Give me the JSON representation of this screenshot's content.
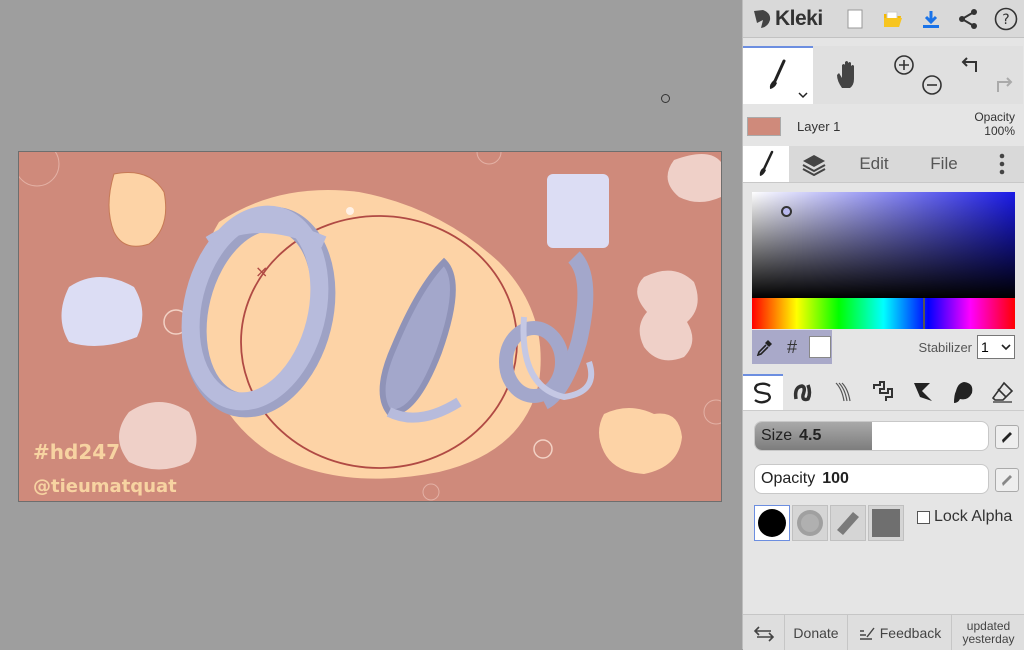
{
  "app": {
    "name": "Kleki"
  },
  "topbar": {
    "icons": [
      "kleki-logo-icon",
      "new-file-icon",
      "open-folder-icon",
      "download-icon",
      "share-icon",
      "help-icon"
    ],
    "accent_color": "#1a73e8"
  },
  "tools": [
    "brush-tool",
    "hand-tool",
    "zoom-in",
    "zoom-out",
    "undo",
    "redo"
  ],
  "layer": {
    "name": "Layer 1",
    "opacity_label": "Opacity",
    "opacity_value": "100%"
  },
  "tabs": {
    "edit": "Edit",
    "file": "File"
  },
  "color": {
    "hex_label": "#",
    "stabilizer_label": "Stabilizer",
    "stabilizer_value": "1",
    "primary_color": "#ffffff",
    "hue_color": "#1a1ae6"
  },
  "brush": {
    "size_label": "Size",
    "size_value": "4.5",
    "size_fraction": 0.5,
    "opacity_label": "Opacity",
    "opacity_value": "100",
    "opacity_fraction": 1.0,
    "lock_alpha_label": "Lock Alpha"
  },
  "canvas": {
    "background_color": "#cf8a7b",
    "lettering": "Old",
    "tag_1": "#hd247",
    "tag_2": "@tieumatquat"
  },
  "footer": {
    "donate": "Donate",
    "feedback": "Feedback",
    "updated_line1": "updated",
    "updated_line2": "yesterday"
  }
}
